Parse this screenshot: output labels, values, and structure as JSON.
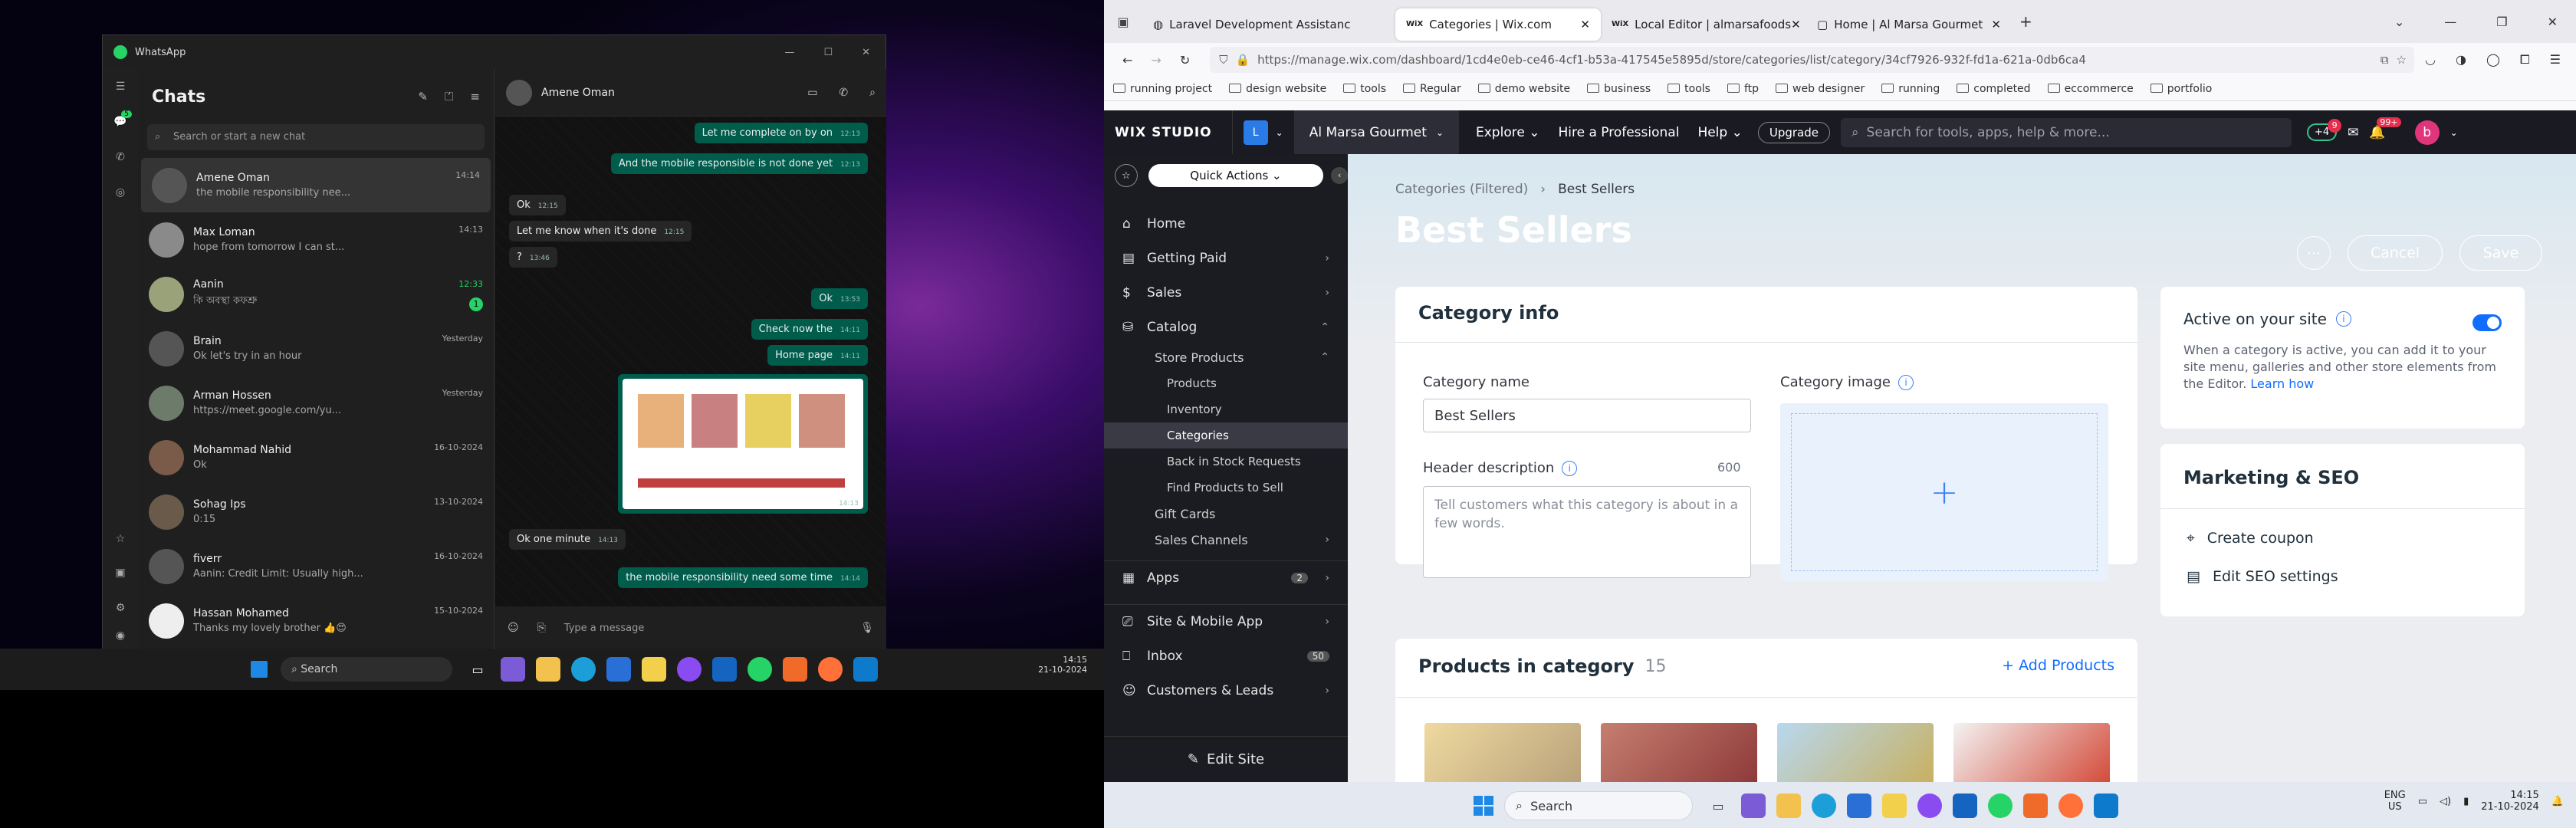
{
  "whatsapp": {
    "app_title": "WhatsApp",
    "chats_title": "Chats",
    "search_placeholder": "Search or start a new chat",
    "unread_count": "5",
    "chats": [
      {
        "name": "Amene Oman",
        "time": "14:14",
        "preview": "the mobile responsibility nee..."
      },
      {
        "name": "Max Loman",
        "time": "14:13",
        "preview": "hope from tomorrow I can st..."
      },
      {
        "name": "Aanin",
        "time": "12:33",
        "preview": "কি অবস্থা কফশ্রু",
        "badge": "1"
      },
      {
        "name": "Brain",
        "time": "Yesterday",
        "preview": "Ok let's try in an hour"
      },
      {
        "name": "Arman Hossen",
        "time": "Yesterday",
        "preview": "https://meet.google.com/yu..."
      },
      {
        "name": "Mohammad Nahid",
        "time": "16-10-2024",
        "preview": "Ok"
      },
      {
        "name": "Sohag Ips",
        "time": "13-10-2024",
        "preview": "0:15"
      },
      {
        "name": "fiverr",
        "time": "16-10-2024",
        "preview": "Aanin: Credit Limit: Usually high..."
      },
      {
        "name": "Hassan Mohamed",
        "time": "15-10-2024",
        "preview": "Thanks my lovely brother 👍😍"
      }
    ],
    "conversation": {
      "contact": "Amene Oman",
      "messages": [
        {
          "text": "Let me complete on by on",
          "time": "12:13"
        },
        {
          "text": "And the mobile responsible is not done yet",
          "time": "12:13"
        },
        {
          "text": "Ok",
          "time": "12:15"
        },
        {
          "text": "Let me know when it's done",
          "time": "12:15"
        },
        {
          "text": "?",
          "time": "13:46"
        },
        {
          "text": "Ok",
          "time": "13:53"
        },
        {
          "text": "Check now the",
          "time": "14:11"
        },
        {
          "text": "Home page",
          "time": "14:11"
        },
        {
          "text": "Ok one minute",
          "time": "14:13"
        },
        {
          "text": "the mobile responsibility need some time",
          "time": "14:14"
        }
      ],
      "image_time": "14:13",
      "compose_placeholder": "Type a message"
    }
  },
  "left_taskbar": {
    "search": "Search",
    "time": "14:15",
    "date": "21-10-2024"
  },
  "browser": {
    "tabs": [
      {
        "title": "Laravel Development Assistanc"
      },
      {
        "title": "Categories | Wix.com"
      },
      {
        "title": "Local Editor | almarsafoods"
      },
      {
        "title": "Home | Al Marsa Gourmet"
      }
    ],
    "url": "https://manage.wix.com/dashboard/1cd4e0eb-ce46-4cf1-b53a-417545e5895d/store/categories/list/category/34cf7926-932f-fd1a-621a-0db6ca4",
    "bookmarks": [
      "running project",
      "design website",
      "tools",
      "Regular",
      "demo website",
      "business",
      "tools",
      "ftp",
      "web designer",
      "running",
      "completed",
      "eccommerce",
      "portfolio"
    ]
  },
  "wix": {
    "brand": "WIX STUDIO",
    "site_letter": "L",
    "site_name": "Al Marsa Gourmet",
    "nav": [
      "Explore",
      "Hire a Professional",
      "Help"
    ],
    "upgrade": "Upgrade",
    "search_placeholder": "Search for tools, apps, help & more...",
    "presence": "+4",
    "chat_badge": "9",
    "notif_badge": "99+",
    "avatar_letter": "b",
    "quick_actions": "Quick Actions",
    "sidebar": {
      "home": "Home",
      "getting_paid": "Getting Paid",
      "sales": "Sales",
      "catalog": "Catalog",
      "store_products": "Store Products",
      "products": "Products",
      "inventory": "Inventory",
      "categories": "Categories",
      "back_in_stock": "Back in Stock Requests",
      "find_products": "Find Products to Sell",
      "gift_cards": "Gift Cards",
      "sales_channels": "Sales Channels",
      "apps": "Apps",
      "apps_count": "2",
      "site_mobile": "Site & Mobile App",
      "inbox": "Inbox",
      "inbox_count": "50",
      "customers": "Customers & Leads",
      "edit_site": "Edit Site"
    },
    "breadcrumb": {
      "parent": "Categories (Filtered)",
      "current": "Best Sellers"
    },
    "page_title": "Best Sellers",
    "cancel": "Cancel",
    "save": "Save",
    "category_info": {
      "title": "Category info",
      "name_label": "Category name",
      "name_value": "Best Sellers",
      "image_label": "Category image",
      "desc_label": "Header description",
      "desc_limit": "600",
      "desc_placeholder": "Tell customers what this category is about in a few words."
    },
    "active": {
      "title": "Active on your site",
      "desc": "When a category is active, you can add it to your site menu, galleries and other store elements from the Editor.",
      "learn": "Learn how"
    },
    "marketing": {
      "title": "Marketing & SEO",
      "coupon": "Create coupon",
      "seo": "Edit SEO settings"
    },
    "products": {
      "title": "Products in category",
      "count": "15",
      "add": "+ Add Products"
    }
  },
  "right_taskbar": {
    "search": "Search",
    "lang1": "ENG",
    "lang2": "US",
    "time": "14:15",
    "date": "21-10-2024"
  }
}
